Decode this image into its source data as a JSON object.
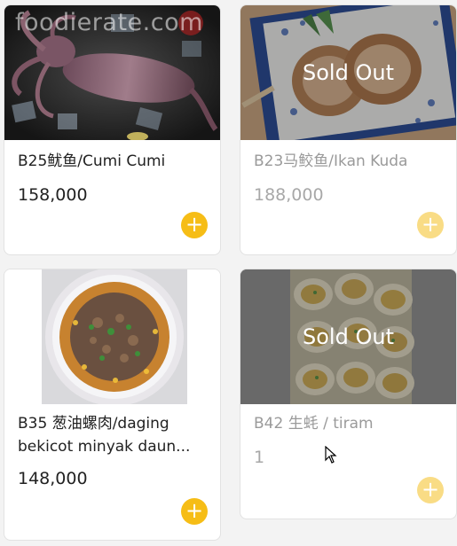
{
  "watermark": "foodierate.com",
  "items": [
    {
      "name": "B25鱿鱼/Cumi Cumi",
      "price": "158,000",
      "sold_out": false,
      "image": "squid-photo"
    },
    {
      "name": "B23马鲛鱼/Ikan Kuda",
      "price": "188,000",
      "sold_out": true,
      "sold_out_label": "Sold Out",
      "image": "fish-steak-photo"
    },
    {
      "name_line1": "B35 葱油螺肉/daging",
      "name_line2": "bekicot minyak daun...",
      "price": "148,000",
      "sold_out": false,
      "image": "snail-meat-bowl-photo"
    },
    {
      "name": "B42 生蚝 / tiram",
      "price": "1",
      "sold_out": true,
      "sold_out_label": "Sold Out",
      "image": "oysters-photo"
    }
  ],
  "add_icon": "+",
  "colors": {
    "accent": "#f6bd16",
    "accent_disabled": "#f9dc85",
    "background": "#f3f3f3",
    "card": "#ffffff"
  }
}
